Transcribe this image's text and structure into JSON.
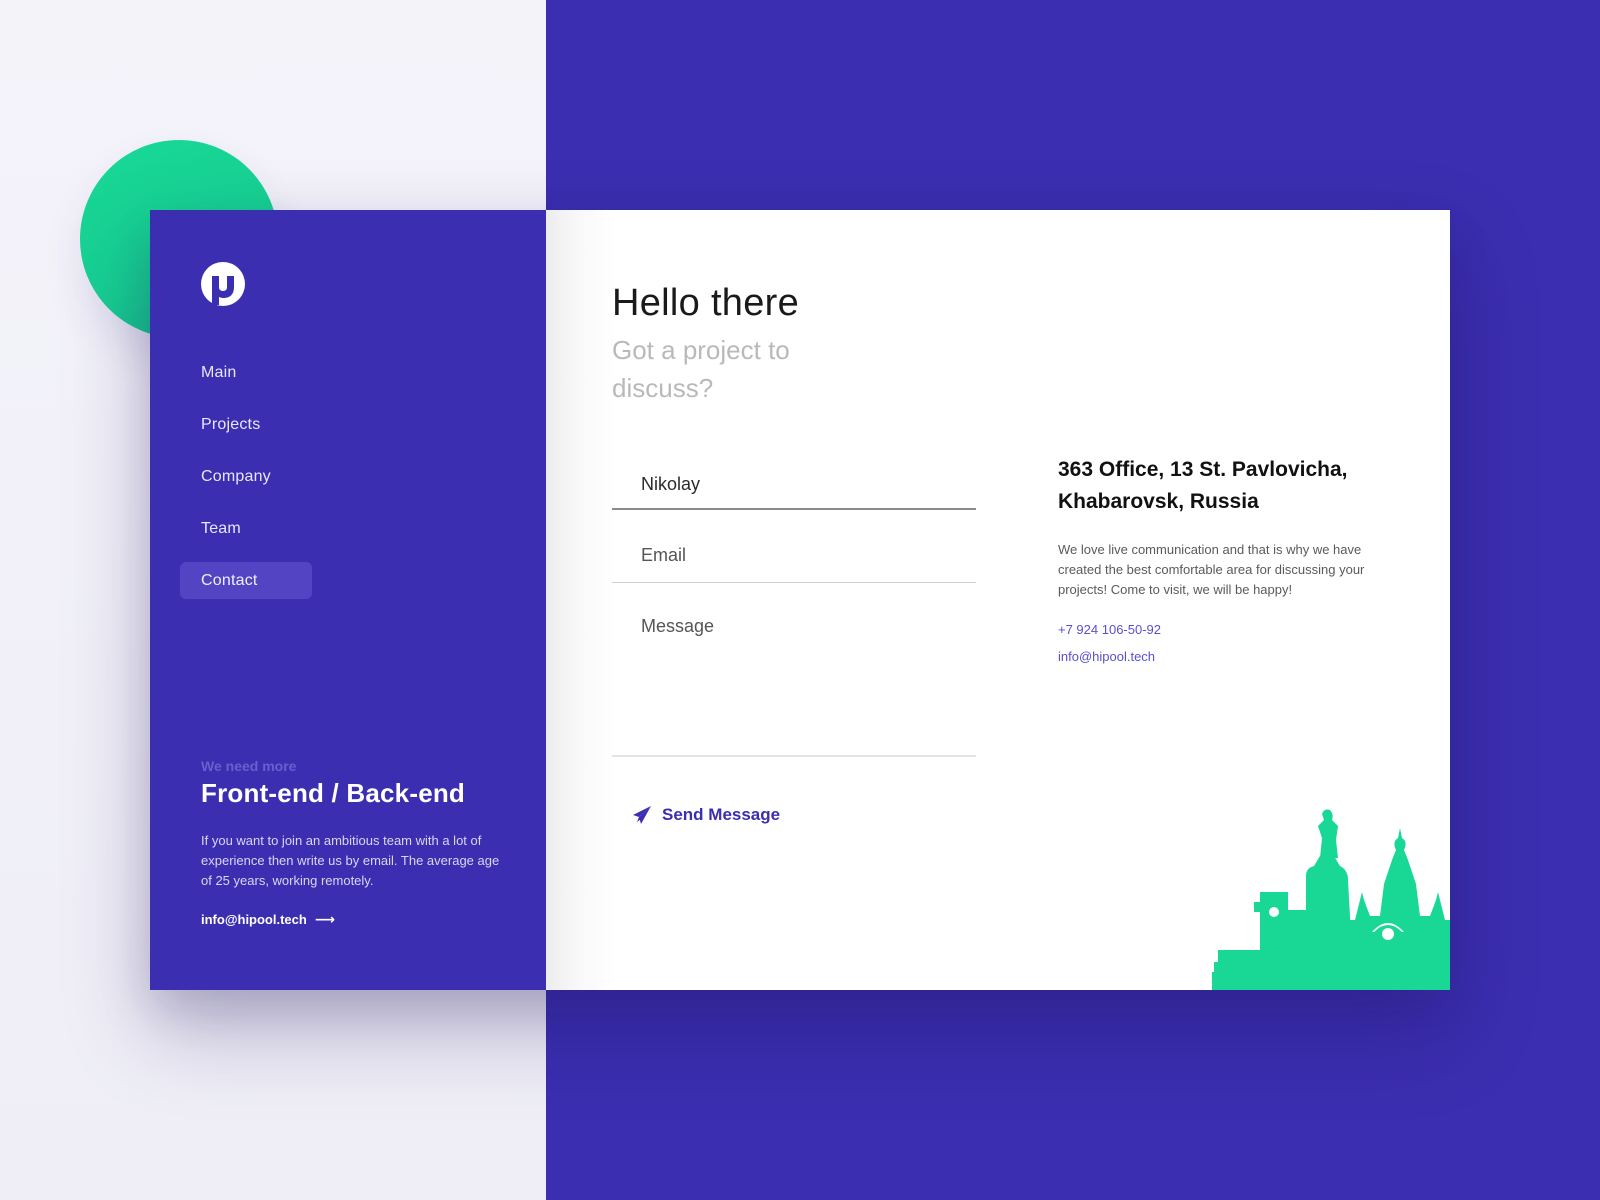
{
  "colors": {
    "brand": "#3b2eb0",
    "accent_green": "#19d896",
    "link": "#5a4fcf"
  },
  "sidebar": {
    "logo": "hipool-logo",
    "nav": [
      {
        "label": "Main",
        "active": false
      },
      {
        "label": "Projects",
        "active": false
      },
      {
        "label": "Company",
        "active": false
      },
      {
        "label": "Team",
        "active": false
      },
      {
        "label": "Contact",
        "active": true
      }
    ],
    "hiring": {
      "eyebrow": "We need more",
      "title": "Front-end / Back-end",
      "body": "If you want to join an ambitious team with a lot of experience then write us by email. The average age of 25 years, working remotely.",
      "email": "info@hipool.tech",
      "arrow_icon": "⟶"
    }
  },
  "main": {
    "title": "Hello there",
    "subtitle": "Got a project to discuss?",
    "form": {
      "name_value": "Nikolay",
      "email_placeholder": "Email",
      "message_placeholder": "Message",
      "send_label": "Send Message",
      "send_icon": "paper-plane-icon"
    },
    "contact": {
      "address": "363 Office, 13 St. Pavlovicha, Khabarovsk, Russia",
      "about": "We love live communication and that is why we have created the best comfortable area for discussing your projects! Come to visit, we will be happy!",
      "phone": "+7 924 106-50-92",
      "email": "info@hipool.tech"
    }
  }
}
